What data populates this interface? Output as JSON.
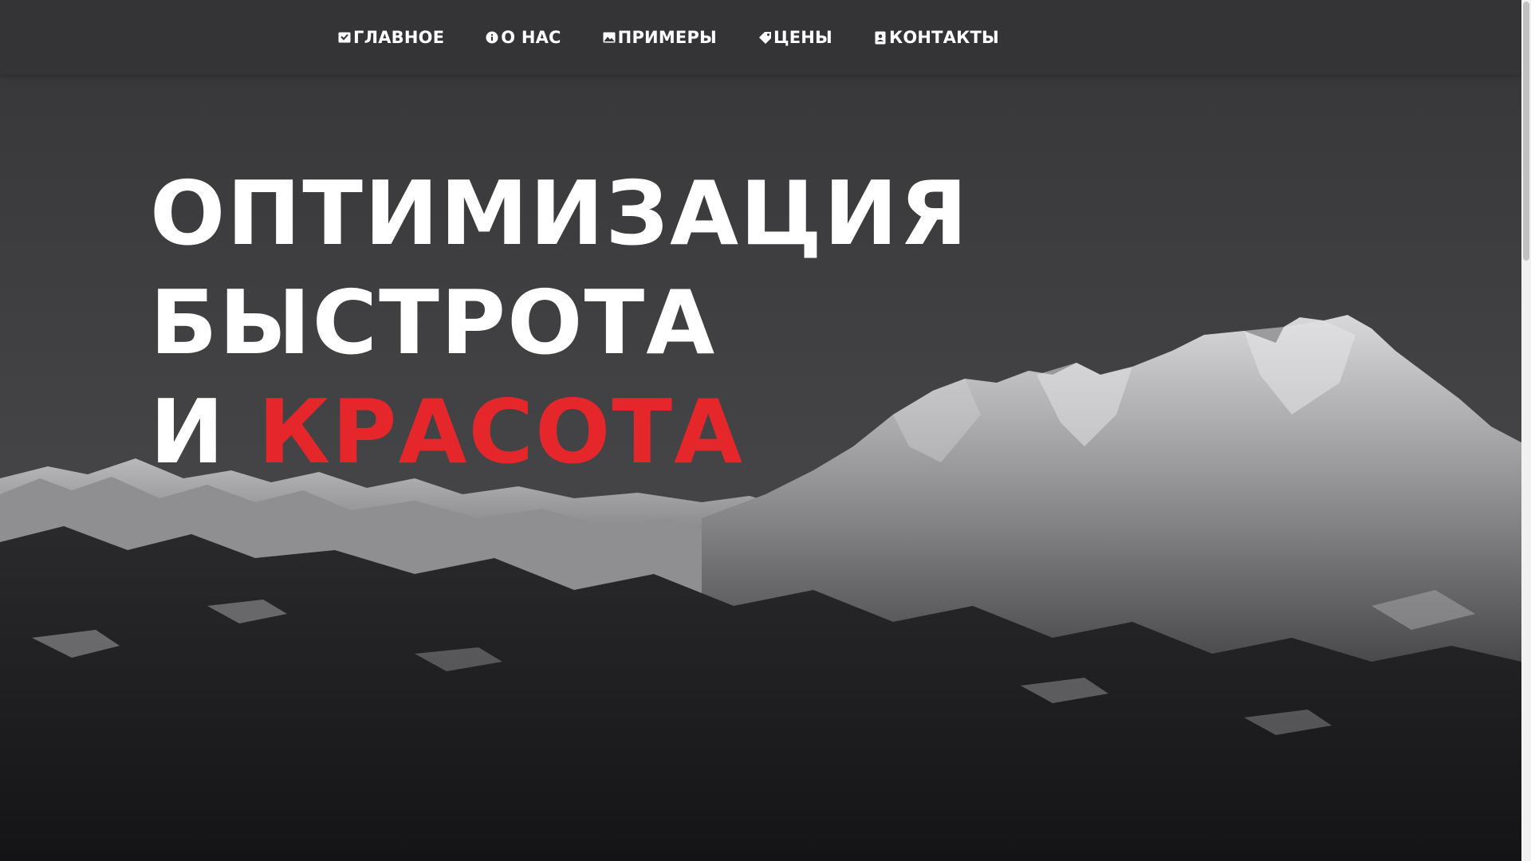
{
  "nav": {
    "items": [
      {
        "label": "ГЛАВНОЕ",
        "icon": "home-icon"
      },
      {
        "label": "О НАС",
        "icon": "info-icon"
      },
      {
        "label": "ПРИМЕРЫ",
        "icon": "image-icon"
      },
      {
        "label": "ЦЕНЫ",
        "icon": "tag-icon"
      },
      {
        "label": "КОНТАКТЫ",
        "icon": "contact-book-icon"
      }
    ]
  },
  "hero": {
    "line1": "ОПТИМИЗАЦИЯ",
    "line2": "БЫСТРОТА",
    "line3_prefix": "И",
    "line3_accent": "КРАСОТА"
  },
  "colors": {
    "accent": "#e5262b",
    "navbar": "#343436",
    "text": "#ffffff"
  }
}
